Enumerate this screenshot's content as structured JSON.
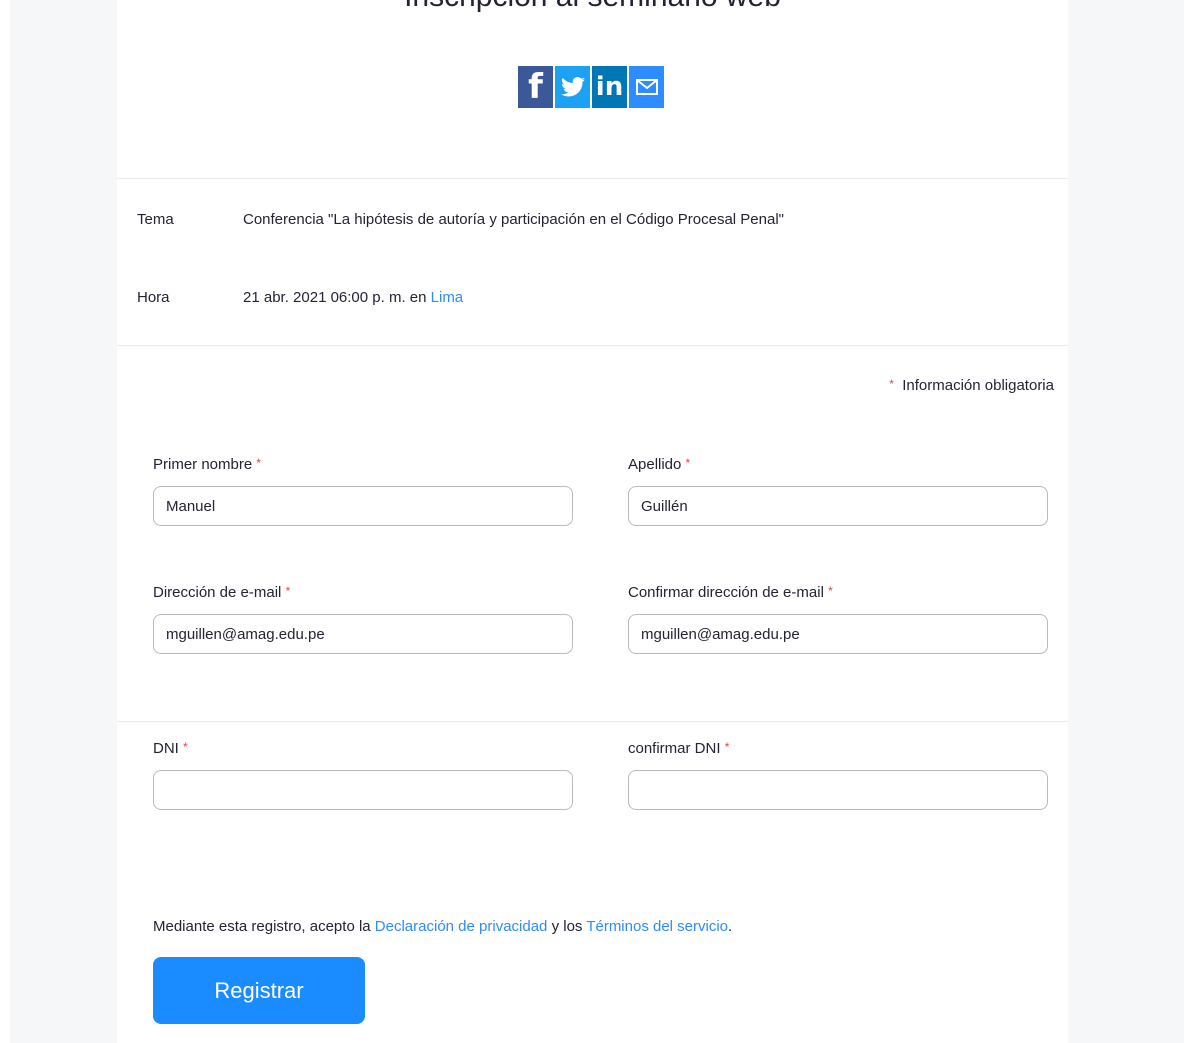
{
  "page": {
    "title": "Inscripción al seminario web"
  },
  "share": {
    "facebook_glyph": "f",
    "linkedin_glyph": "in",
    "icons": [
      "facebook-icon",
      "twitter-icon",
      "linkedin-icon",
      "email-icon"
    ],
    "colors": {
      "facebook": "#3b5998",
      "twitter": "#1da1f2",
      "linkedin": "#0077b5",
      "email": "#2d8cff"
    }
  },
  "details": {
    "topic_label": "Tema",
    "topic_value": "Conferencia \"La hipótesis de autoría y participación en el Código Procesal Penal\"",
    "time_label": "Hora",
    "time_value": "21 abr. 2021 06:00 p. m. en ",
    "time_zone_link": "Lima"
  },
  "form": {
    "required_star": "*",
    "required_note": "Información obligatoria",
    "first_name": {
      "label": "Primer nombre",
      "value": "Manuel"
    },
    "last_name": {
      "label": "Apellido",
      "value": "Guillén"
    },
    "email": {
      "label": "Dirección de e-mail",
      "value": "mguillen@amag.edu.pe"
    },
    "confirm_email": {
      "label": "Confirmar dirección de e-mail",
      "value": "mguillen@amag.edu.pe"
    },
    "dni": {
      "label": "DNI",
      "value": ""
    },
    "confirm_dni": {
      "label": "confirmar DNI",
      "value": ""
    }
  },
  "terms": {
    "prefix": "Mediante esta registro, acepto la ",
    "privacy_link": "Declaración de privacidad",
    "middle": " y los ",
    "tos_link": "Términos del servicio",
    "suffix": "."
  },
  "submit": {
    "label": "Registrar"
  },
  "colors": {
    "accent": "#2d8cff",
    "button": "#1a8cff",
    "required": "#e8404b",
    "sidebar_bg": "#f6f7f9"
  }
}
